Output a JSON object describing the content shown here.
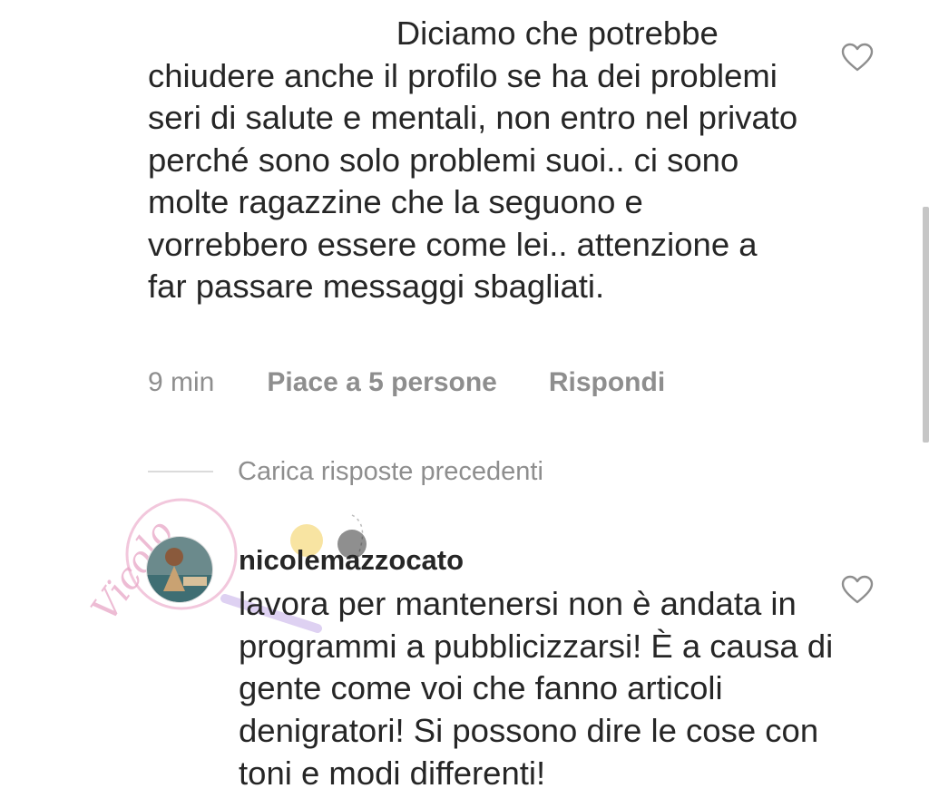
{
  "comment": {
    "text": "               Diciamo che potrebbe chiudere anche il profilo se ha dei problemi seri di salute e mentali, non entro nel privato perché sono solo problemi suoi.. ci sono molte ragazzine che la seguono e vorrebbero essere come lei.. attenzione a far passare messaggi sbagliati.",
    "time": "9 min",
    "likes_label": "Piace a 5 persone",
    "reply_label": "Rispondi"
  },
  "load_previous_label": "Carica risposte precedenti",
  "reply": {
    "username": "nicolemazzocato",
    "text": "lavora per mantenersi non è andata in programmi a pubblicizzarsi! È a causa di gente come voi che fanno articoli denigratori! Si possono dire le cose con toni e modi differenti!"
  },
  "watermark": {
    "text": "Vicolo"
  },
  "icons": {
    "like": "heart-outline-icon"
  },
  "colors": {
    "text": "#262626",
    "muted": "#8e8e8e",
    "divider": "#dbdbdb",
    "watermark": "#e8a6c6"
  }
}
